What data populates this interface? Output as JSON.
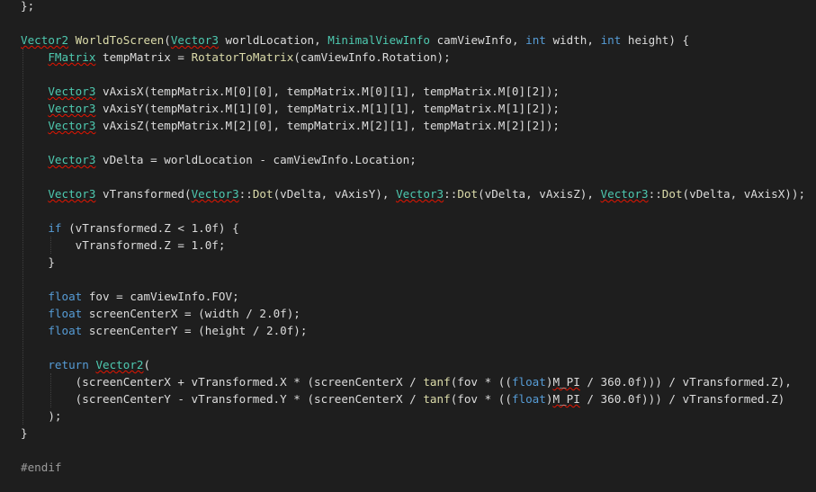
{
  "editor": {
    "theme": {
      "background": "#1e1e1e",
      "text": "#dcdcdc",
      "keyword": "#569cd6",
      "type": "#4ec9b0",
      "function": "#dcdcaa",
      "preprocessor": "#9b9b9b",
      "error_squiggle": "#e51400"
    },
    "lines": [
      [
        {
          "t": "};",
          "c": "pu"
        }
      ],
      [],
      [
        {
          "t": "Vector2",
          "c": "ty",
          "sq": true
        },
        {
          "t": " "
        },
        {
          "t": "WorldToScreen",
          "c": "fn"
        },
        {
          "t": "("
        },
        {
          "t": "Vector3",
          "c": "ty",
          "sq": true
        },
        {
          "t": " worldLocation, "
        },
        {
          "t": "MinimalViewInfo",
          "c": "ty"
        },
        {
          "t": " camViewInfo, "
        },
        {
          "t": "int",
          "c": "kw"
        },
        {
          "t": " width, "
        },
        {
          "t": "int",
          "c": "kw"
        },
        {
          "t": " height) {"
        }
      ],
      [
        {
          "t": "    "
        },
        {
          "t": "FMatrix",
          "c": "ty",
          "sq": true
        },
        {
          "t": " tempMatrix = "
        },
        {
          "t": "RotatorToMatrix",
          "c": "fn"
        },
        {
          "t": "(camViewInfo.Rotation);"
        }
      ],
      [],
      [
        {
          "t": "    "
        },
        {
          "t": "Vector3",
          "c": "ty",
          "sq": true
        },
        {
          "t": " vAxisX(tempMatrix.M[0][0], tempMatrix.M[0][1], tempMatrix.M[0][2]);"
        }
      ],
      [
        {
          "t": "    "
        },
        {
          "t": "Vector3",
          "c": "ty",
          "sq": true
        },
        {
          "t": " vAxisY(tempMatrix.M[1][0], tempMatrix.M[1][1], tempMatrix.M[1][2]);"
        }
      ],
      [
        {
          "t": "    "
        },
        {
          "t": "Vector3",
          "c": "ty",
          "sq": true
        },
        {
          "t": " vAxisZ(tempMatrix.M[2][0], tempMatrix.M[2][1], tempMatrix.M[2][2]);"
        }
      ],
      [],
      [
        {
          "t": "    "
        },
        {
          "t": "Vector3",
          "c": "ty",
          "sq": true
        },
        {
          "t": " vDelta = worldLocation - camViewInfo.Location;"
        }
      ],
      [],
      [
        {
          "t": "    "
        },
        {
          "t": "Vector3",
          "c": "ty",
          "sq": true
        },
        {
          "t": " vTransformed("
        },
        {
          "t": "Vector3",
          "c": "ty",
          "sq": true
        },
        {
          "t": "::"
        },
        {
          "t": "Dot",
          "c": "fn"
        },
        {
          "t": "(vDelta, vAxisY), "
        },
        {
          "t": "Vector3",
          "c": "ty",
          "sq": true
        },
        {
          "t": "::"
        },
        {
          "t": "Dot",
          "c": "fn"
        },
        {
          "t": "(vDelta, vAxisZ), "
        },
        {
          "t": "Vector3",
          "c": "ty",
          "sq": true
        },
        {
          "t": "::"
        },
        {
          "t": "Dot",
          "c": "fn"
        },
        {
          "t": "(vDelta, vAxisX));"
        }
      ],
      [],
      [
        {
          "t": "    "
        },
        {
          "t": "if",
          "c": "kw"
        },
        {
          "t": " (vTransformed.Z < 1.0f) {"
        }
      ],
      [
        {
          "t": "        vTransformed.Z = 1.0f;"
        }
      ],
      [
        {
          "t": "    }"
        }
      ],
      [],
      [
        {
          "t": "    "
        },
        {
          "t": "float",
          "c": "kw"
        },
        {
          "t": " fov = camViewInfo.FOV;"
        }
      ],
      [
        {
          "t": "    "
        },
        {
          "t": "float",
          "c": "kw"
        },
        {
          "t": " screenCenterX = (width / 2.0f);"
        }
      ],
      [
        {
          "t": "    "
        },
        {
          "t": "float",
          "c": "kw"
        },
        {
          "t": " screenCenterY = (height / 2.0f);"
        }
      ],
      [],
      [
        {
          "t": "    "
        },
        {
          "t": "return",
          "c": "kw"
        },
        {
          "t": " "
        },
        {
          "t": "Vector2",
          "c": "ty",
          "sq": true
        },
        {
          "t": "("
        }
      ],
      [
        {
          "t": "        (screenCenterX + vTransformed.X * (screenCenterX / "
        },
        {
          "t": "tanf",
          "c": "fn"
        },
        {
          "t": "(fov * (("
        },
        {
          "t": "float",
          "c": "kw"
        },
        {
          "t": ")"
        },
        {
          "t": "M_PI",
          "sq": true
        },
        {
          "t": " / 360.0f))) / vTransformed.Z),"
        }
      ],
      [
        {
          "t": "        (screenCenterY - vTransformed.Y * (screenCenterX / "
        },
        {
          "t": "tanf",
          "c": "fn"
        },
        {
          "t": "(fov * (("
        },
        {
          "t": "float",
          "c": "kw"
        },
        {
          "t": ")"
        },
        {
          "t": "M_PI",
          "sq": true
        },
        {
          "t": " / 360.0f))) / vTransformed.Z)"
        }
      ],
      [
        {
          "t": "    );"
        }
      ],
      [
        {
          "t": "}"
        }
      ],
      [],
      [
        {
          "t": "#endif",
          "c": "pp"
        }
      ]
    ]
  }
}
